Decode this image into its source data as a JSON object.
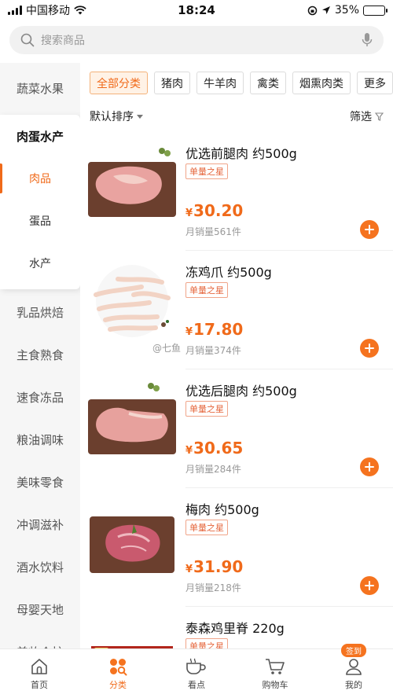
{
  "status_bar": {
    "carrier": "中国移动",
    "time": "18:24",
    "battery": "35%",
    "battery_level": 0.35
  },
  "search": {
    "placeholder": "搜索商品"
  },
  "sidebar": {
    "categories_top": [
      {
        "label": "蔬菜水果"
      }
    ],
    "expanded": {
      "label": "肉蛋水产",
      "subcategories": [
        {
          "label": "肉品",
          "active": true
        },
        {
          "label": "蛋品",
          "active": false
        },
        {
          "label": "水产",
          "active": false
        }
      ]
    },
    "categories_bottom": [
      {
        "label": "乳品烘焙"
      },
      {
        "label": "主食熟食"
      },
      {
        "label": "速食冻品"
      },
      {
        "label": "粮油调味"
      },
      {
        "label": "美味零食"
      },
      {
        "label": "冲调滋补"
      },
      {
        "label": "酒水饮料"
      },
      {
        "label": "母婴天地"
      },
      {
        "label": "美妆个护"
      }
    ]
  },
  "filter_chips": [
    {
      "label": "全部分类",
      "active": true
    },
    {
      "label": "猪肉",
      "active": false
    },
    {
      "label": "牛羊肉",
      "active": false
    },
    {
      "label": "禽类",
      "active": false
    },
    {
      "label": "烟熏肉类",
      "active": false
    },
    {
      "label": "更多",
      "active": false
    }
  ],
  "sort": {
    "label": "默认排序",
    "filter_label": "筛选"
  },
  "products": [
    {
      "name": "优选前腿肉 约500g",
      "badge": "单量之星",
      "currency": "¥",
      "price": "30.20",
      "sales": "月销量561件",
      "image": "pork-front-leg"
    },
    {
      "name": "冻鸡爪 约500g",
      "badge": "单量之星",
      "currency": "¥",
      "price": "17.80",
      "sales": "月销量374件",
      "image": "chicken-feet"
    },
    {
      "name": "优选后腿肉 约500g",
      "badge": "单量之星",
      "currency": "¥",
      "price": "30.65",
      "sales": "月销量284件",
      "image": "pork-hind-leg"
    },
    {
      "name": "梅肉 约500g",
      "badge": "单量之星",
      "currency": "¥",
      "price": "31.90",
      "sales": "月销量218件",
      "image": "pork-shoulder"
    },
    {
      "name": "泰森鸡里脊 220g",
      "badge": "单量之星",
      "currency": "¥",
      "price": "",
      "sales": "",
      "image": "tyson-chicken-pack"
    }
  ],
  "watermark": "@七鱼",
  "tabs": [
    {
      "label": "首页",
      "icon": "home-icon",
      "active": false
    },
    {
      "label": "分类",
      "icon": "category-icon",
      "active": true
    },
    {
      "label": "看点",
      "icon": "coffee-cup-icon",
      "active": false
    },
    {
      "label": "购物车",
      "icon": "cart-icon",
      "active": false
    },
    {
      "label": "我的",
      "icon": "user-icon",
      "active": false,
      "badge": "签到"
    }
  ],
  "colors": {
    "accent": "#f06a1a",
    "add_button": "#f5731f",
    "badge_text": "#e5643a"
  }
}
